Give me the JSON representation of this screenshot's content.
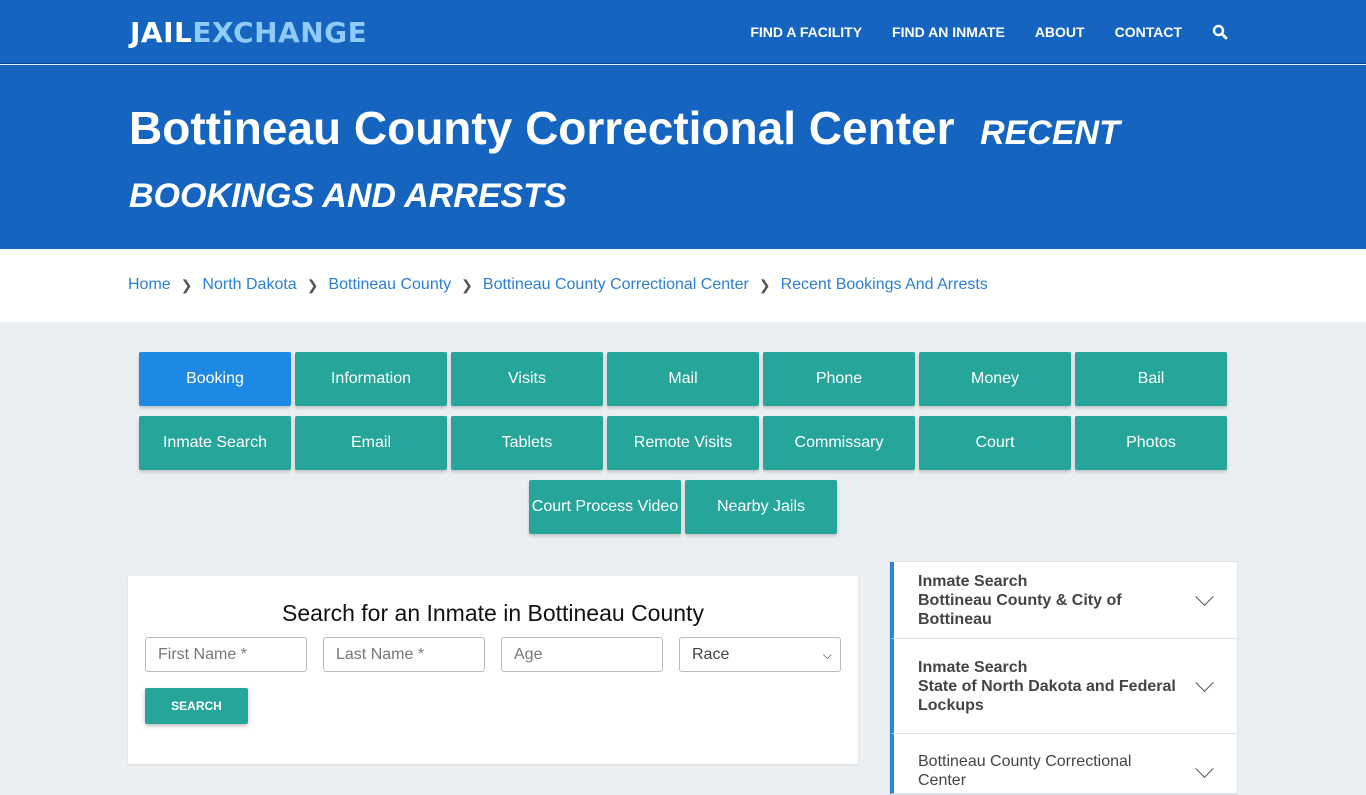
{
  "header": {
    "logo_part1": "JAIL",
    "logo_part2": "EXCHANGE",
    "nav": [
      {
        "label": "FIND A FACILITY"
      },
      {
        "label": "FIND AN INMATE"
      },
      {
        "label": "ABOUT"
      },
      {
        "label": "CONTACT"
      }
    ],
    "search_icon": "search-icon"
  },
  "hero": {
    "title": "Bottineau County Correctional Center",
    "subtitle": "RECENT BOOKINGS AND ARRESTS"
  },
  "breadcrumb": [
    {
      "label": "Home"
    },
    {
      "label": "North Dakota"
    },
    {
      "label": "Bottineau County"
    },
    {
      "label": "Bottineau County Correctional Center"
    },
    {
      "label": "Recent Bookings And Arrests"
    }
  ],
  "buttons": [
    {
      "label": "Booking",
      "active": true
    },
    {
      "label": "Information"
    },
    {
      "label": "Visits"
    },
    {
      "label": "Mail"
    },
    {
      "label": "Phone"
    },
    {
      "label": "Money"
    },
    {
      "label": "Bail"
    },
    {
      "label": "Inmate Search"
    },
    {
      "label": "Email"
    },
    {
      "label": "Tablets"
    },
    {
      "label": "Remote Visits"
    },
    {
      "label": "Commissary"
    },
    {
      "label": "Court"
    },
    {
      "label": "Photos"
    },
    {
      "label": "Court Process Video"
    },
    {
      "label": "Nearby Jails"
    }
  ],
  "search": {
    "title": "Search for an Inmate in Bottineau County",
    "first_name_placeholder": "First Name *",
    "last_name_placeholder": "Last Name *",
    "age_placeholder": "Age",
    "race_selected": "Race",
    "submit_label": "SEARCH"
  },
  "sidebar": {
    "items": [
      {
        "line1": "Inmate Search",
        "line2": "Bottineau County & City of Bottineau"
      },
      {
        "line1": "Inmate Search",
        "line2": "State of North Dakota and Federal Lockups"
      },
      {
        "line3": "Bottineau County Correctional Center"
      }
    ]
  },
  "colors": {
    "brand_blue": "#1565c0",
    "teal": "#26a69a",
    "active_blue": "#1e88e5",
    "link_blue": "#2b7fd1"
  }
}
